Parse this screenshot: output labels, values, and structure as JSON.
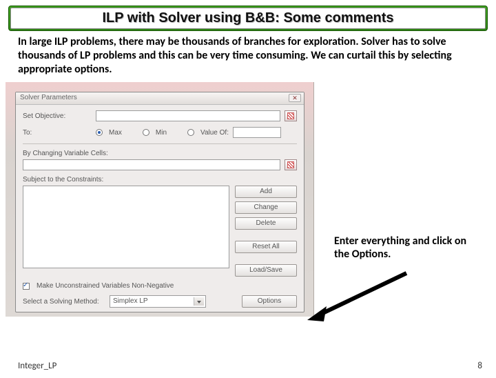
{
  "title": "ILP with Solver using B&B: Some comments",
  "body": "In large ILP problems, there may be thousands of branches for exploration. Solver has to solve thousands of LP problems and  this can be very time consuming. We can curtail this by selecting appropriate options.",
  "dialog": {
    "title": "Solver Parameters",
    "set_objective": "Set Objective:",
    "to": "To:",
    "opt_max": "Max",
    "opt_min": "Min",
    "opt_value": "Value Of:",
    "changing": "By Changing Variable Cells:",
    "subject": "Subject to the Constraints:",
    "btn_add": "Add",
    "btn_change": "Change",
    "btn_delete": "Delete",
    "btn_reset": "Reset All",
    "btn_loadsave": "Load/Save",
    "nonneg": "Make Unconstrained Variables Non-Negative",
    "method_label": "Select a Solving Method:",
    "method_value": "Simplex LP",
    "btn_options": "Options"
  },
  "annotation": "Enter everything and click on the Options.",
  "footer": {
    "left": "Integer_LP",
    "page": "8"
  }
}
